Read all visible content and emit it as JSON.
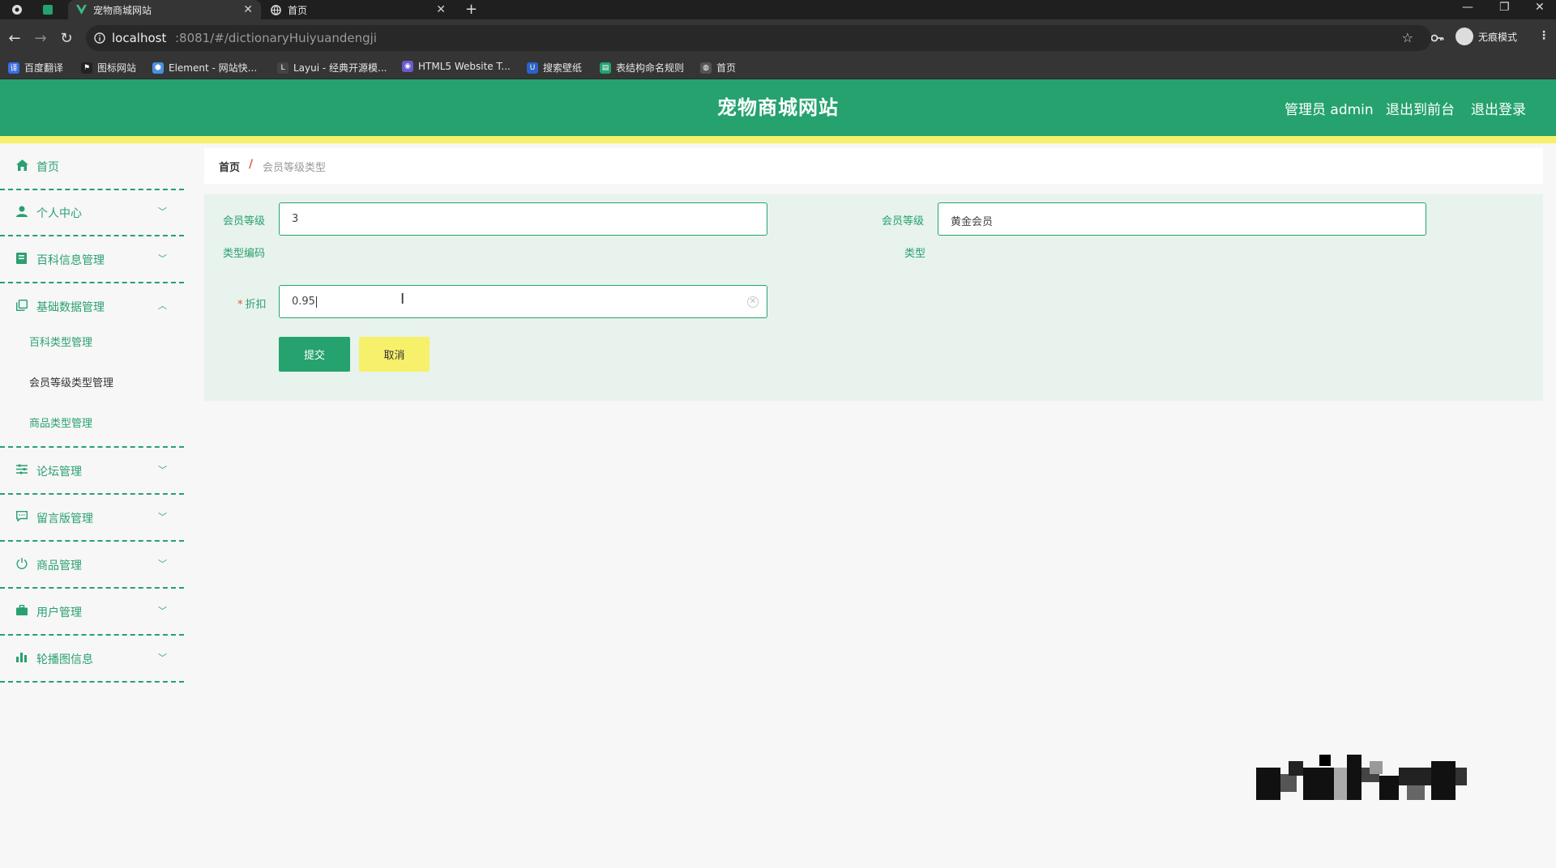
{
  "browser": {
    "tabs": [
      {
        "title": "宠物商城网站",
        "active": true
      },
      {
        "title": "首页",
        "active": false
      }
    ],
    "url_host": "localhost",
    "url_path": ":8081/#/dictionaryHuiyuandengji",
    "profile_label": "无痕模式",
    "bookmarks": [
      {
        "label": "百度翻译",
        "color": "#3b6fe0"
      },
      {
        "label": "图标网站",
        "color": "#222222"
      },
      {
        "label": "Element - 网站快...",
        "color": "#4a90e2"
      },
      {
        "label": "Layui - 经典开源模...",
        "color": "#444444"
      },
      {
        "label": "HTML5 Website T...",
        "color": "#6a5acd"
      },
      {
        "label": "搜索壁纸",
        "color": "#2a62c9"
      },
      {
        "label": "表结构命名规则",
        "color": "#25a26e"
      },
      {
        "label": "首页",
        "color": "#555555"
      }
    ]
  },
  "header": {
    "site_title": "宠物商城网站",
    "admin_label": "管理员 admin",
    "back_front_label": "退出到前台",
    "logout_label": "退出登录",
    "brand_color": "#25a26e",
    "accent_color": "#f7f06a"
  },
  "sidebar": {
    "items": [
      {
        "label": "首页",
        "icon": "home-icon"
      },
      {
        "label": "个人中心",
        "icon": "user-icon",
        "arrow": "﹀"
      },
      {
        "label": "百科信息管理",
        "icon": "book-icon",
        "arrow": "﹀"
      },
      {
        "label": "基础数据管理",
        "icon": "copy-icon",
        "arrow": "︿"
      },
      {
        "label": "论坛管理",
        "icon": "sliders-icon",
        "arrow": "﹀"
      },
      {
        "label": "留言版管理",
        "icon": "message-icon",
        "arrow": "﹀"
      },
      {
        "label": "商品管理",
        "icon": "power-icon",
        "arrow": "﹀"
      },
      {
        "label": "用户管理",
        "icon": "briefcase-icon",
        "arrow": "﹀"
      },
      {
        "label": "轮播图信息",
        "icon": "bar-chart-icon",
        "arrow": "﹀"
      }
    ],
    "sub_items": [
      {
        "label": "百科类型管理",
        "active": false
      },
      {
        "label": "会员等级类型管理",
        "active": true
      },
      {
        "label": "商品类型管理",
        "active": false
      }
    ]
  },
  "breadcrumb": {
    "home": "首页",
    "separator": "/",
    "current": "会员等级类型"
  },
  "form": {
    "code_label_1": "会员等级",
    "code_label_2": "类型编码",
    "code_value": "3",
    "type_label_1": "会员等级",
    "type_label_2": "类型",
    "type_value": "黄金会员",
    "discount_required": "*",
    "discount_label": "折扣",
    "discount_value": "0.95",
    "submit_label": "提交",
    "cancel_label": "取消"
  }
}
